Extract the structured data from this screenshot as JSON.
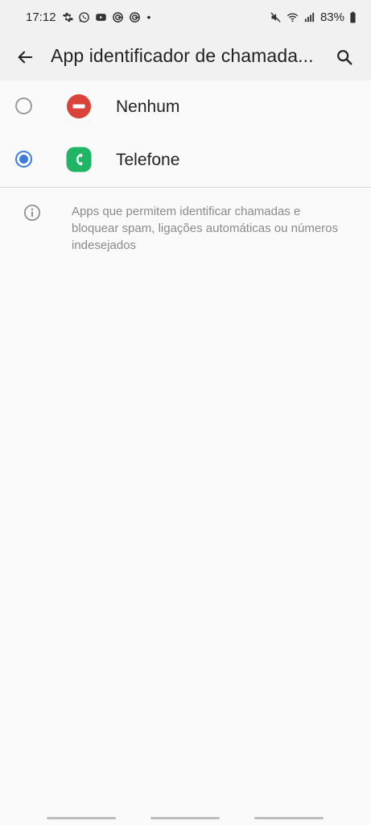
{
  "status_bar": {
    "time": "17:12",
    "battery": "83%",
    "notification_icons": [
      "gear-icon",
      "whatsapp-icon",
      "youtube-icon",
      "tasker-icon",
      "tasker-icon",
      "dot-icon"
    ],
    "system_icons": [
      "mute-icon",
      "wifi-icon",
      "signal-icon",
      "battery-icon"
    ]
  },
  "app_bar": {
    "title": "App identificador de chamada...",
    "back_icon": "arrow-left-icon",
    "search_icon": "search-icon"
  },
  "options": [
    {
      "label": "Nenhum",
      "icon": "none-icon",
      "icon_color": "#d9433a",
      "selected": false
    },
    {
      "label": "Telefone",
      "icon": "phone-app-icon",
      "icon_color": "#1fb565",
      "selected": true
    }
  ],
  "info": {
    "icon": "info-icon",
    "text": "Apps que permitem identificar chamadas e bloquear spam, ligações automáticas ou números indesejados"
  },
  "colors": {
    "accent": "#3e7bdc",
    "background": "#fafafa",
    "app_bar": "#f1f1f1"
  }
}
